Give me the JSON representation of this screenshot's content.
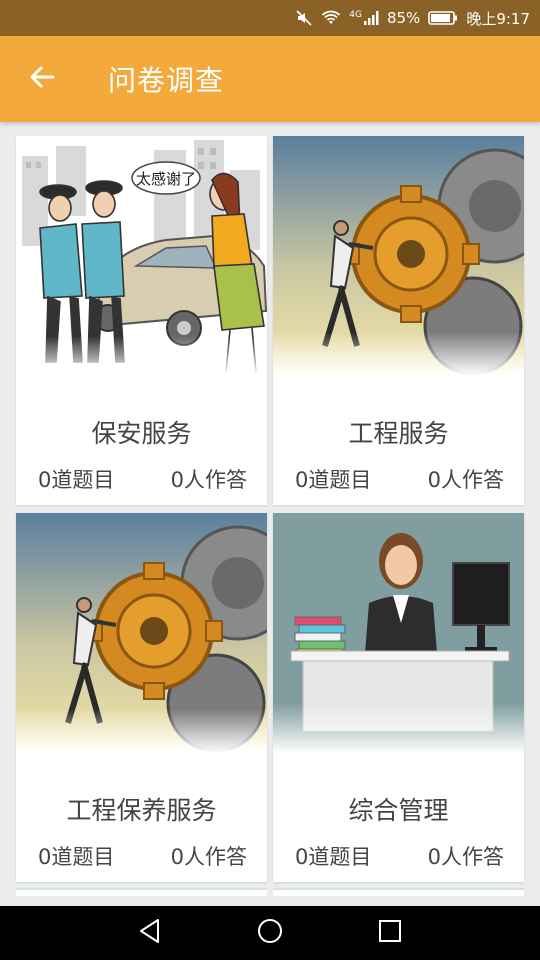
{
  "status_bar": {
    "battery_percent": "85%",
    "time": "晚上9:17",
    "network": "4G",
    "icons": [
      "mute-icon",
      "wifi-icon",
      "signal-icon",
      "battery-icon"
    ]
  },
  "app_bar": {
    "back_icon": "arrow-left-icon",
    "title": "问卷调查"
  },
  "colors": {
    "status_bar": "#8a6227",
    "app_bar": "#f4a93c",
    "background": "#ececec"
  },
  "cards": [
    {
      "title": "保安服务",
      "questions": "0道题目",
      "answers": "0人作答",
      "image": "security-guards-illustration"
    },
    {
      "title": "工程服务",
      "questions": "0道题目",
      "answers": "0人作答",
      "image": "man-pushing-gear-photo"
    },
    {
      "title": "工程保养服务",
      "questions": "0道题目",
      "answers": "0人作答",
      "image": "man-pushing-gear-photo"
    },
    {
      "title": "综合管理",
      "questions": "0道题目",
      "answers": "0人作答",
      "image": "office-receptionist-illustration"
    }
  ],
  "callout_text": "太感谢了",
  "nav_bar": {
    "icons": [
      "back-triangle-icon",
      "home-circle-icon",
      "recents-square-icon"
    ]
  }
}
